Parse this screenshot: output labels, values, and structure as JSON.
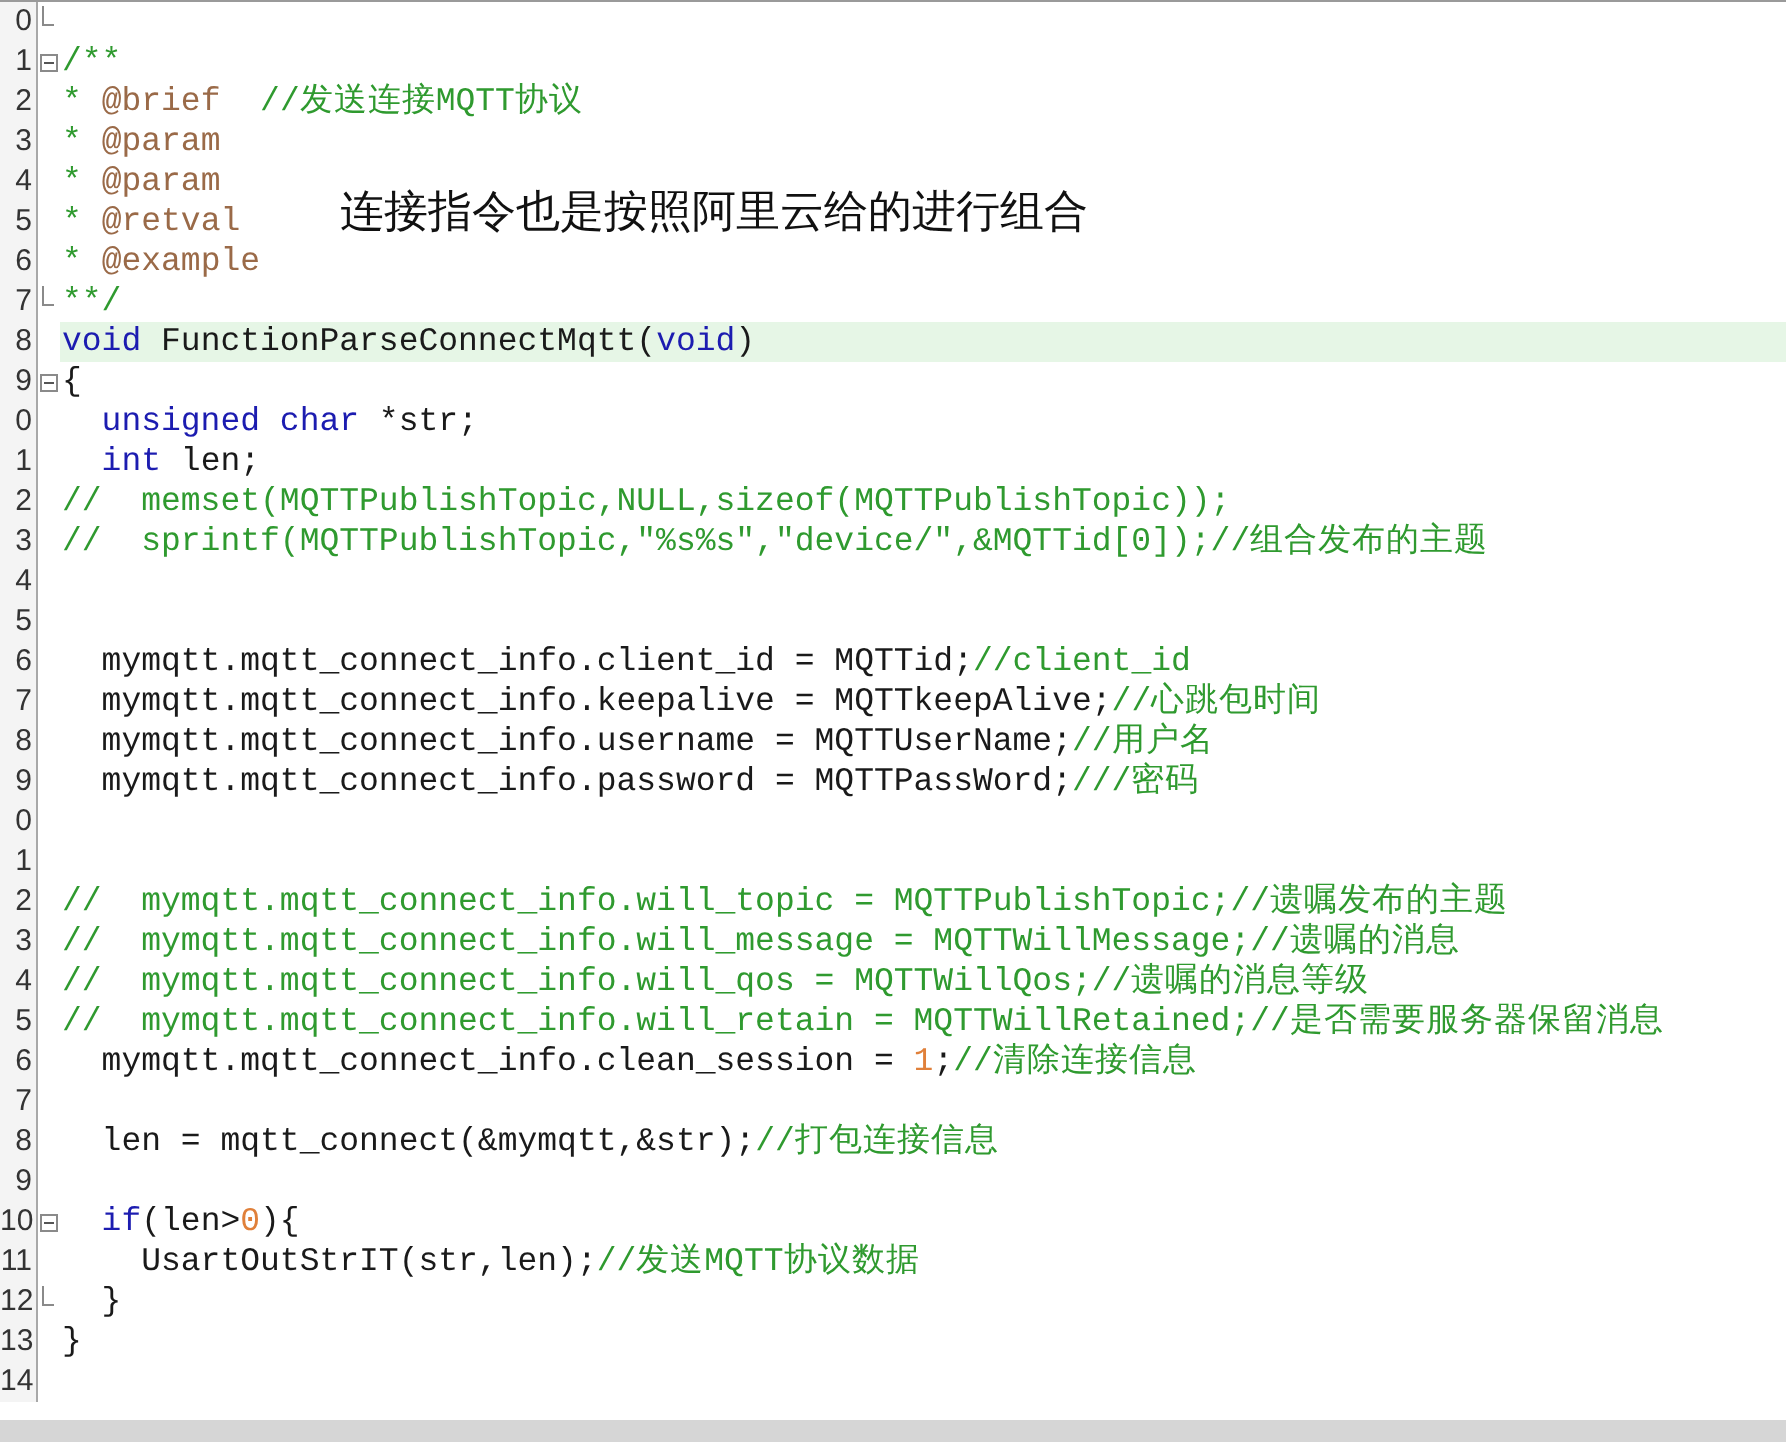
{
  "editor": {
    "lines": [
      {
        "number": "0",
        "collapsible": false,
        "fold_end": true,
        "highlighted": false
      },
      {
        "number": "1",
        "collapsible": true,
        "fold_end": false,
        "highlighted": false,
        "segments": [
          {
            "kind": "comment",
            "text": "/**"
          }
        ]
      },
      {
        "number": "2",
        "collapsible": false,
        "fold_end": false,
        "highlighted": false,
        "segments": [
          {
            "kind": "comment",
            "text": "* "
          },
          {
            "kind": "doc-tag",
            "text": "@brief"
          },
          {
            "kind": "comment",
            "text": "  //发送连接MQTT协议"
          }
        ]
      },
      {
        "number": "3",
        "collapsible": false,
        "fold_end": false,
        "highlighted": false,
        "segments": [
          {
            "kind": "comment",
            "text": "* "
          },
          {
            "kind": "doc-tag",
            "text": "@param"
          }
        ]
      },
      {
        "number": "4",
        "collapsible": false,
        "fold_end": false,
        "highlighted": false,
        "segments": [
          {
            "kind": "comment",
            "text": "* "
          },
          {
            "kind": "doc-tag",
            "text": "@param"
          }
        ]
      },
      {
        "number": "5",
        "collapsible": false,
        "fold_end": false,
        "highlighted": false,
        "segments": [
          {
            "kind": "comment",
            "text": "* "
          },
          {
            "kind": "doc-tag",
            "text": "@retval"
          }
        ]
      },
      {
        "number": "6",
        "collapsible": false,
        "fold_end": false,
        "highlighted": false,
        "segments": [
          {
            "kind": "comment",
            "text": "* "
          },
          {
            "kind": "doc-tag",
            "text": "@example"
          }
        ]
      },
      {
        "number": "7",
        "collapsible": false,
        "fold_end": true,
        "highlighted": false,
        "segments": [
          {
            "kind": "comment",
            "text": "**/"
          }
        ]
      },
      {
        "number": "8",
        "collapsible": false,
        "fold_end": false,
        "highlighted": true,
        "segments": [
          {
            "kind": "keyword",
            "text": "void"
          },
          {
            "kind": "plain",
            "text": " FunctionParseConnectMqtt("
          },
          {
            "kind": "keyword",
            "text": "void"
          },
          {
            "kind": "plain",
            "text": ")"
          }
        ]
      },
      {
        "number": "9",
        "collapsible": true,
        "fold_end": false,
        "highlighted": false,
        "segments": [
          {
            "kind": "plain",
            "text": "{"
          }
        ]
      },
      {
        "number": "0",
        "collapsible": false,
        "fold_end": false,
        "highlighted": false,
        "segments": [
          {
            "kind": "keyword",
            "text": "  unsigned char"
          },
          {
            "kind": "plain",
            "text": " *str;"
          }
        ]
      },
      {
        "number": "1",
        "collapsible": false,
        "fold_end": false,
        "highlighted": false,
        "segments": [
          {
            "kind": "keyword",
            "text": "  int"
          },
          {
            "kind": "plain",
            "text": " len;"
          }
        ]
      },
      {
        "number": "2",
        "collapsible": false,
        "fold_end": false,
        "highlighted": false,
        "segments": [
          {
            "kind": "comment",
            "text": "//  memset(MQTTPublishTopic,NULL,sizeof(MQTTPublishTopic));"
          }
        ]
      },
      {
        "number": "3",
        "collapsible": false,
        "fold_end": false,
        "highlighted": false,
        "segments": [
          {
            "kind": "comment",
            "text": "//  sprintf(MQTTPublishTopic,\"%s%s\",\"device/\",&MQTTid[0]);//组合发布的主题"
          }
        ]
      },
      {
        "number": "4",
        "collapsible": false,
        "fold_end": false,
        "highlighted": false
      },
      {
        "number": "5",
        "collapsible": false,
        "fold_end": false,
        "highlighted": false
      },
      {
        "number": "6",
        "collapsible": false,
        "fold_end": false,
        "highlighted": false,
        "segments": [
          {
            "kind": "plain",
            "text": "  mymqtt.mqtt_connect_info.client_id = MQTTid;"
          },
          {
            "kind": "comment",
            "text": "//client_id"
          }
        ]
      },
      {
        "number": "7",
        "collapsible": false,
        "fold_end": false,
        "highlighted": false,
        "segments": [
          {
            "kind": "plain",
            "text": "  mymqtt.mqtt_connect_info.keepalive = MQTTkeepAlive;"
          },
          {
            "kind": "comment",
            "text": "//心跳包时间"
          }
        ]
      },
      {
        "number": "8",
        "collapsible": false,
        "fold_end": false,
        "highlighted": false,
        "segments": [
          {
            "kind": "plain",
            "text": "  mymqtt.mqtt_connect_info.username = MQTTUserName;"
          },
          {
            "kind": "comment",
            "text": "//用户名"
          }
        ]
      },
      {
        "number": "9",
        "collapsible": false,
        "fold_end": false,
        "highlighted": false,
        "segments": [
          {
            "kind": "plain",
            "text": "  mymqtt.mqtt_connect_info.password = MQTTPassWord;"
          },
          {
            "kind": "comment",
            "text": "///密码"
          }
        ]
      },
      {
        "number": "0",
        "collapsible": false,
        "fold_end": false,
        "highlighted": false
      },
      {
        "number": "1",
        "collapsible": false,
        "fold_end": false,
        "highlighted": false
      },
      {
        "number": "2",
        "collapsible": false,
        "fold_end": false,
        "highlighted": false,
        "segments": [
          {
            "kind": "comment",
            "text": "//  mymqtt.mqtt_connect_info.will_topic = MQTTPublishTopic;//遗嘱发布的主题"
          }
        ]
      },
      {
        "number": "3",
        "collapsible": false,
        "fold_end": false,
        "highlighted": false,
        "segments": [
          {
            "kind": "comment",
            "text": "//  mymqtt.mqtt_connect_info.will_message = MQTTWillMessage;//遗嘱的消息"
          }
        ]
      },
      {
        "number": "4",
        "collapsible": false,
        "fold_end": false,
        "highlighted": false,
        "segments": [
          {
            "kind": "comment",
            "text": "//  mymqtt.mqtt_connect_info.will_qos = MQTTWillQos;//遗嘱的消息等级"
          }
        ]
      },
      {
        "number": "5",
        "collapsible": false,
        "fold_end": false,
        "highlighted": false,
        "segments": [
          {
            "kind": "comment",
            "text": "//  mymqtt.mqtt_connect_info.will_retain = MQTTWillRetained;//是否需要服务器保留消息"
          }
        ]
      },
      {
        "number": "6",
        "collapsible": false,
        "fold_end": false,
        "highlighted": false,
        "segments": [
          {
            "kind": "plain",
            "text": "  mymqtt.mqtt_connect_info.clean_session = "
          },
          {
            "kind": "number",
            "text": "1"
          },
          {
            "kind": "plain",
            "text": ";"
          },
          {
            "kind": "comment",
            "text": "//清除连接信息"
          }
        ]
      },
      {
        "number": "7",
        "collapsible": false,
        "fold_end": false,
        "highlighted": false
      },
      {
        "number": "8",
        "collapsible": false,
        "fold_end": false,
        "highlighted": false,
        "segments": [
          {
            "kind": "plain",
            "text": "  len = mqtt_connect(&mymqtt,&str);"
          },
          {
            "kind": "comment",
            "text": "//打包连接信息"
          }
        ]
      },
      {
        "number": "9",
        "collapsible": false,
        "fold_end": false,
        "highlighted": false
      },
      {
        "number": "10",
        "collapsible": true,
        "fold_end": false,
        "highlighted": false,
        "segments": [
          {
            "kind": "keyword",
            "text": "  if"
          },
          {
            "kind": "plain",
            "text": "(len>"
          },
          {
            "kind": "number",
            "text": "0"
          },
          {
            "kind": "plain",
            "text": "){"
          }
        ]
      },
      {
        "number": "11",
        "collapsible": false,
        "fold_end": false,
        "highlighted": false,
        "segments": [
          {
            "kind": "plain",
            "text": "    UsartOutStrIT(str,len);"
          },
          {
            "kind": "comment",
            "text": "//发送MQTT协议数据"
          }
        ]
      },
      {
        "number": "12",
        "collapsible": false,
        "fold_end": true,
        "highlighted": false,
        "segments": [
          {
            "kind": "plain",
            "text": "  }"
          }
        ]
      },
      {
        "number": "13",
        "collapsible": false,
        "fold_end": false,
        "highlighted": false,
        "segments": [
          {
            "kind": "plain",
            "text": "}"
          }
        ]
      },
      {
        "number": "14",
        "collapsible": false,
        "fold_end": false,
        "highlighted": false
      }
    ]
  },
  "annotation": {
    "text": "连接指令也是按照阿里云给的进行组合"
  }
}
